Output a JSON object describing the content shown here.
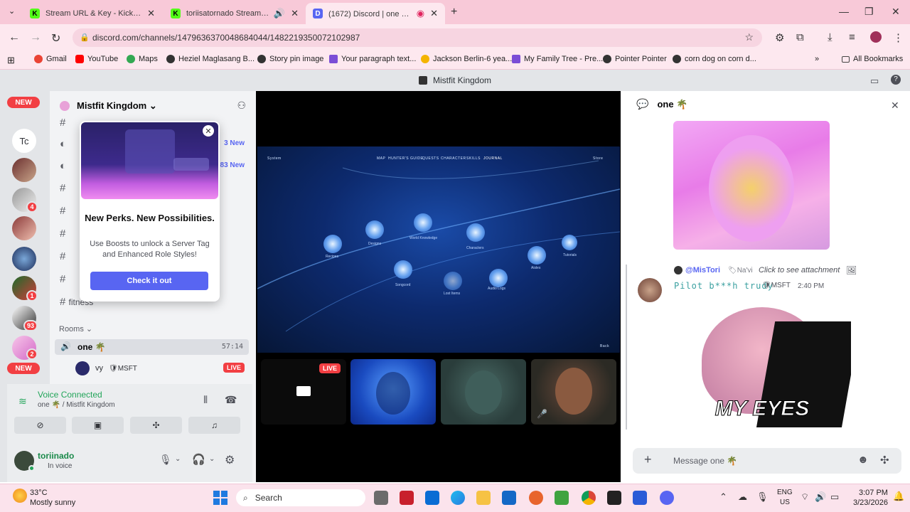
{
  "browser": {
    "tabs": [
      {
        "title": "Stream URL & Key - Kick Dashb",
        "favicon": "K",
        "active": false
      },
      {
        "title": "toriisatornado Stream - Wa",
        "favicon": "K",
        "active": false
      },
      {
        "title": "(1672) Discord | one 🌴 | M",
        "favicon": "D",
        "active": true
      }
    ],
    "url": "discord.com/channels/1479636370048684044/1482219350072102987",
    "bookmarks": [
      "Gmail",
      "YouTube",
      "Maps",
      "Heziel Maglasang B...",
      "Story pin image",
      "Your paragraph text...",
      "Jackson Berlin-6 yea...",
      "My Family Tree - Pre...",
      "Pointer Pointer",
      "corn dog on corn d..."
    ],
    "all_bookmarks": "All Bookmarks"
  },
  "discord": {
    "window_title": "Mistfit Kingdom",
    "guild_badges": {
      "new_top": "NEW",
      "new_bottom": "NEW",
      "tc": "Tc",
      "b1": "4",
      "b2": "1",
      "b3": "93",
      "b4": "2"
    },
    "server_name": "Mistfit Kingdom",
    "channel_new_1": "3 New",
    "channel_new_2": "83 New",
    "channel_last": "fitness",
    "rooms_label": "Rooms",
    "voice_channel": {
      "name": "one 🌴",
      "timer": "57:14"
    },
    "voice_user": {
      "name": "vy",
      "tag": "MSFT",
      "live": "LIVE"
    },
    "popup": {
      "title": "New Perks. New Possibilities.",
      "body": "Use Boosts to unlock a Server Tag and Enhanced Role Styles!",
      "button": "Check it out"
    },
    "voice_panel": {
      "status": "Voice Connected",
      "location": "one 🌴 / Mistfit Kingdom"
    },
    "user": {
      "name": "toriinado",
      "status": "In voice"
    },
    "stage": {
      "tile_live": "LIVE",
      "game_menu": [
        "System",
        "MAP",
        "HUNTER'S GUIDE",
        "QUESTS",
        "CHARACTER",
        "SKILLS",
        "JOURNAL",
        "Store"
      ],
      "game_nodes": [
        "Recipes",
        "Designs",
        "World Knowledge",
        "Characters",
        "Tutorials",
        "Songcord",
        "Lost Items",
        "Audio Logs",
        "Aisles"
      ],
      "game_back": "Back"
    },
    "thread": {
      "title": "one 🌴",
      "message": {
        "reply_user": "@MisTori",
        "reply_tag": "Na'vi",
        "reply_text": "Click to see attachment",
        "author": "Pilot b***h trudy",
        "author_tag": "MSFT",
        "time": "2:40 PM",
        "meme_caption": "MY EYES"
      },
      "composer_placeholder": "Message one 🌴"
    }
  },
  "taskbar": {
    "weather_temp": "33°C",
    "weather_desc": "Mostly sunny",
    "search": "Search",
    "lang": "ENG",
    "region": "US",
    "time": "3:07 PM",
    "date": "3/23/2026"
  }
}
